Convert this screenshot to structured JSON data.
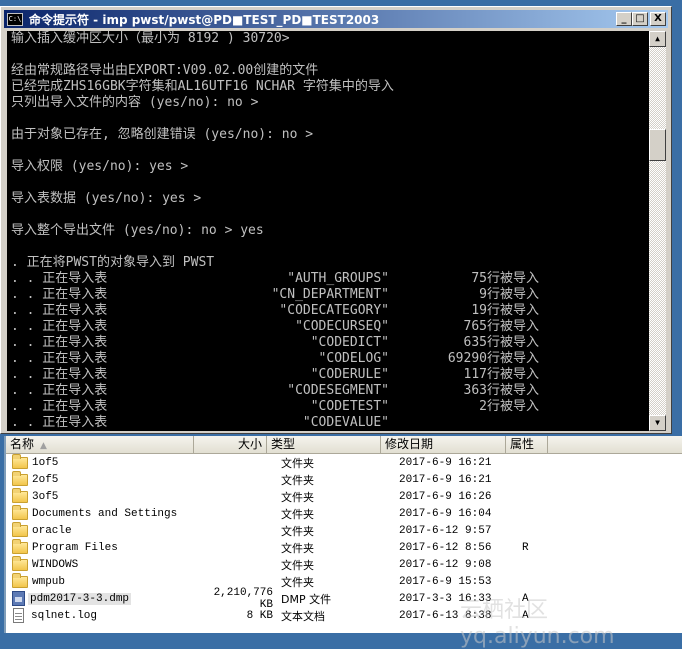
{
  "console": {
    "title": "命令提示符 - imp pwst/pwst@PD■TEST_PD■TEST2003",
    "icon_label": "C:\\",
    "buttons": {
      "minimize": "_",
      "maximize": "□",
      "close": "X"
    },
    "lines": [
      "输入插入缓冲区大小（最小为 8192 ) 30720>",
      "",
      "经由常规路径导出由EXPORT:V09.02.00创建的文件",
      "已经完成ZHS16GBK字符集和AL16UTF16 NCHAR 字符集中的导入",
      "只列出导入文件的内容 (yes/no): no >",
      "",
      "由于对象已存在, 忽略创建错误 (yes/no): no >",
      "",
      "导入权限 (yes/no): yes >",
      "",
      "导入表数据 (yes/no): yes >",
      "",
      "导入整个导出文件 (yes/no): no > yes",
      "",
      ". 正在将PWST的对象导入到 PWST"
    ],
    "imports": [
      {
        "prefix": ". . 正在导入表",
        "table": "\"AUTH_GROUPS\"",
        "rows": "75行被导入"
      },
      {
        "prefix": ". . 正在导入表",
        "table": "\"CN_DEPARTMENT\"",
        "rows": "9行被导入"
      },
      {
        "prefix": ". . 正在导入表",
        "table": "\"CODECATEGORY\"",
        "rows": "19行被导入"
      },
      {
        "prefix": ". . 正在导入表",
        "table": "\"CODECURSEQ\"",
        "rows": "765行被导入"
      },
      {
        "prefix": ". . 正在导入表",
        "table": "\"CODEDICT\"",
        "rows": "635行被导入"
      },
      {
        "prefix": ". . 正在导入表",
        "table": "\"CODELOG\"",
        "rows": "69290行被导入"
      },
      {
        "prefix": ". . 正在导入表",
        "table": "\"CODERULE\"",
        "rows": "117行被导入"
      },
      {
        "prefix": ". . 正在导入表",
        "table": "\"CODESEGMENT\"",
        "rows": "363行被导入"
      },
      {
        "prefix": ". . 正在导入表",
        "table": "\"CODETEST\"",
        "rows": "2行被导入"
      },
      {
        "prefix": ". . 正在导入表",
        "table": "\"CODEVALUE\"",
        "rows": ""
      }
    ],
    "scrollbar": {
      "up": "▲",
      "down": "▼"
    }
  },
  "explorer": {
    "columns": {
      "name": "名称",
      "size": "大小",
      "type": "类型",
      "date": "修改日期",
      "attr": "属性",
      "sort_indicator": "▲"
    },
    "files": [
      {
        "icon": "folder-icon",
        "name": "1of5",
        "size": "",
        "type": "文件夹",
        "date": "2017-6-9 16:21",
        "attr": ""
      },
      {
        "icon": "folder-icon",
        "name": "2of5",
        "size": "",
        "type": "文件夹",
        "date": "2017-6-9 16:21",
        "attr": ""
      },
      {
        "icon": "folder-icon",
        "name": "3of5",
        "size": "",
        "type": "文件夹",
        "date": "2017-6-9 16:26",
        "attr": ""
      },
      {
        "icon": "folder-icon",
        "name": "Documents and Settings",
        "size": "",
        "type": "文件夹",
        "date": "2017-6-9 16:04",
        "attr": ""
      },
      {
        "icon": "folder-icon",
        "name": "oracle",
        "size": "",
        "type": "文件夹",
        "date": "2017-6-12 9:57",
        "attr": ""
      },
      {
        "icon": "folder-icon",
        "name": "Program Files",
        "size": "",
        "type": "文件夹",
        "date": "2017-6-12 8:56",
        "attr": "R"
      },
      {
        "icon": "folder-icon",
        "name": "WINDOWS",
        "size": "",
        "type": "文件夹",
        "date": "2017-6-12 9:08",
        "attr": ""
      },
      {
        "icon": "folder-icon",
        "name": "wmpub",
        "size": "",
        "type": "文件夹",
        "date": "2017-6-9 15:53",
        "attr": ""
      },
      {
        "icon": "dmp-file-icon",
        "name": "pdm2017-3-3.dmp",
        "size": "2,210,776 KB",
        "type": "DMP 文件",
        "date": "2017-3-3 16:33",
        "attr": "A",
        "selected": true
      },
      {
        "icon": "text-file-icon",
        "name": "sqlnet.log",
        "size": "8 KB",
        "type": "文本文档",
        "date": "2017-6-13 8:38",
        "attr": "A"
      }
    ]
  },
  "watermark": "云栖社区 yq.aliyun.com"
}
